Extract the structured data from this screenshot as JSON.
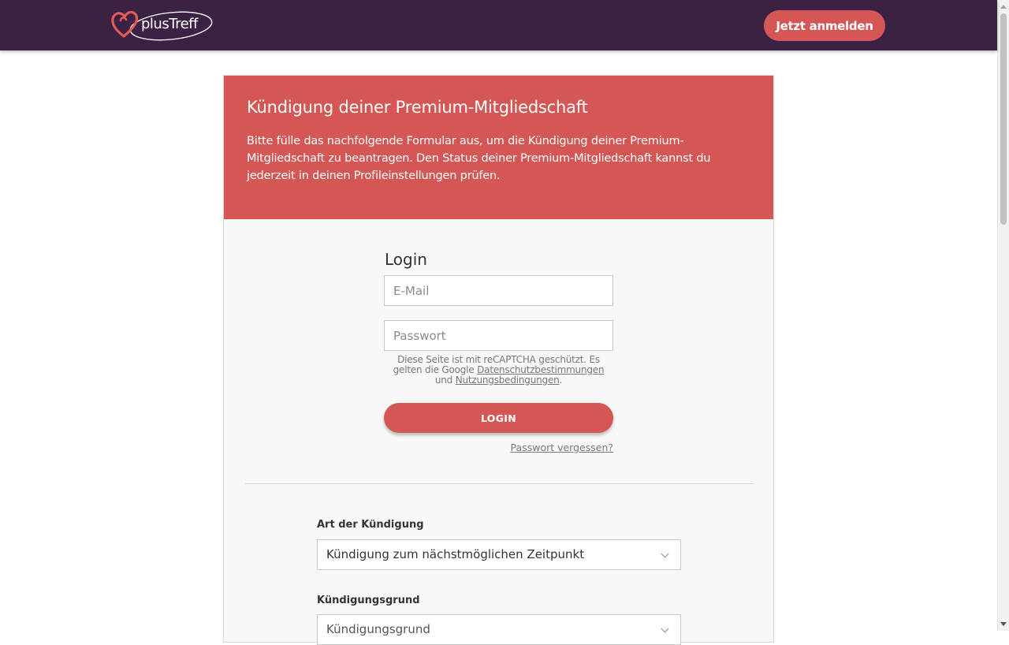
{
  "header": {
    "logo_text": "plusTreff",
    "cta_label": "Jetzt anmelden"
  },
  "card": {
    "title": "Kündigung deiner Premium-Mitgliedschaft",
    "intro": "Bitte fülle das nachfolgende Formular aus, um die Kündigung deiner Premium-Mitgliedschaft zu beantragen. Den Status deiner Premium-Mitgliedschaft kannst du jederzeit in deinen Profileinstellungen prüfen."
  },
  "login": {
    "title": "Login",
    "email_placeholder": "E-Mail",
    "email_value": "",
    "password_placeholder": "Passwort",
    "password_value": "",
    "recaptcha_text_1": "Diese Seite ist mit reCAPTCHA geschützt. Es gelten die Google",
    "recaptcha_link_privacy": "Datenschutzbestimmungen",
    "recaptcha_text_2": "und",
    "recaptcha_link_terms": "Nutzungsbedingungen",
    "recaptcha_text_3": ".",
    "button_label": "LOGIN",
    "forgot_label": "Passwort vergessen?"
  },
  "cancellation": {
    "type_label": "Art der Kündigung",
    "type_value": "Kündigung zum nächstmöglichen Zeitpunkt",
    "reason_label": "Kündigungsgrund",
    "reason_value": "Kündigungsgrund"
  },
  "colors": {
    "header_bg": "#3b2245",
    "accent": "#d45756"
  }
}
